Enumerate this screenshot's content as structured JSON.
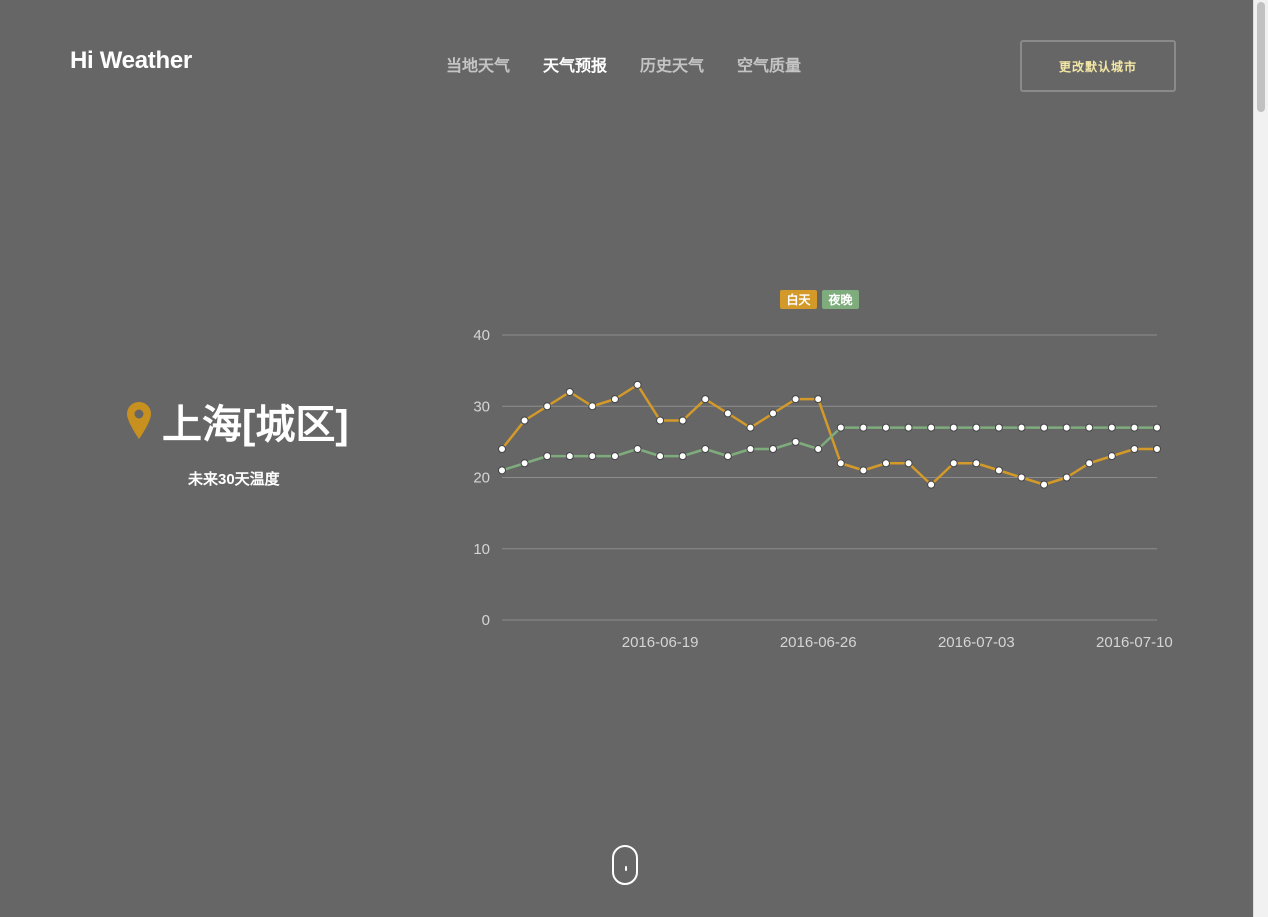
{
  "brand": "Hi Weather",
  "nav": [
    {
      "label": "当地天气",
      "active": false
    },
    {
      "label": "天气预报",
      "active": true
    },
    {
      "label": "历史天气",
      "active": false
    },
    {
      "label": "空气质量",
      "active": false
    }
  ],
  "change_city_button": "更改默认城市",
  "city": {
    "name": "上海[城区]",
    "subtitle": "未来30天温度"
  },
  "icons": {
    "location": "map-pin-icon",
    "scroll": "scroll-down-icon"
  },
  "colors": {
    "day": "#d39a2a",
    "night": "#7fac7d",
    "background": "#666666",
    "button_text": "#f3e7a6"
  },
  "chart_data": {
    "type": "line",
    "legend_placement": "top-center",
    "grid": true,
    "ylim": [
      0,
      40
    ],
    "y_ticks": [
      0,
      10,
      20,
      30,
      40
    ],
    "x_tick_labels": [
      "2016-06-19",
      "2016-06-26",
      "2016-07-03",
      "2016-07-10"
    ],
    "x": [
      "2016-06-14",
      "2016-06-15",
      "2016-06-16",
      "2016-06-17",
      "2016-06-18",
      "2016-06-19",
      "2016-06-20",
      "2016-06-21",
      "2016-06-22",
      "2016-06-23",
      "2016-06-24",
      "2016-06-25",
      "2016-06-26",
      "2016-06-27",
      "2016-06-28",
      "2016-06-29",
      "2016-06-30",
      "2016-07-01",
      "2016-07-02",
      "2016-07-03",
      "2016-07-04",
      "2016-07-05",
      "2016-07-06",
      "2016-07-07",
      "2016-07-08",
      "2016-07-09",
      "2016-07-10"
    ],
    "series": [
      {
        "name": "白天",
        "color": "#d39a2a",
        "values": [
          24,
          28,
          30,
          32,
          30,
          31,
          33,
          28,
          28,
          31,
          29,
          27,
          29,
          31,
          31,
          22,
          21,
          22,
          22,
          19,
          22,
          22,
          21,
          20,
          19,
          20,
          22,
          23,
          24,
          24
        ]
      },
      {
        "name": "夜晚",
        "color": "#7fac7d",
        "values": [
          21,
          22,
          23,
          23,
          23,
          23,
          24,
          23,
          23,
          24,
          23,
          24,
          24,
          25,
          24,
          27,
          27,
          27,
          27,
          27,
          27,
          27,
          27,
          27,
          27,
          27,
          27,
          27,
          27,
          27
        ]
      }
    ]
  }
}
